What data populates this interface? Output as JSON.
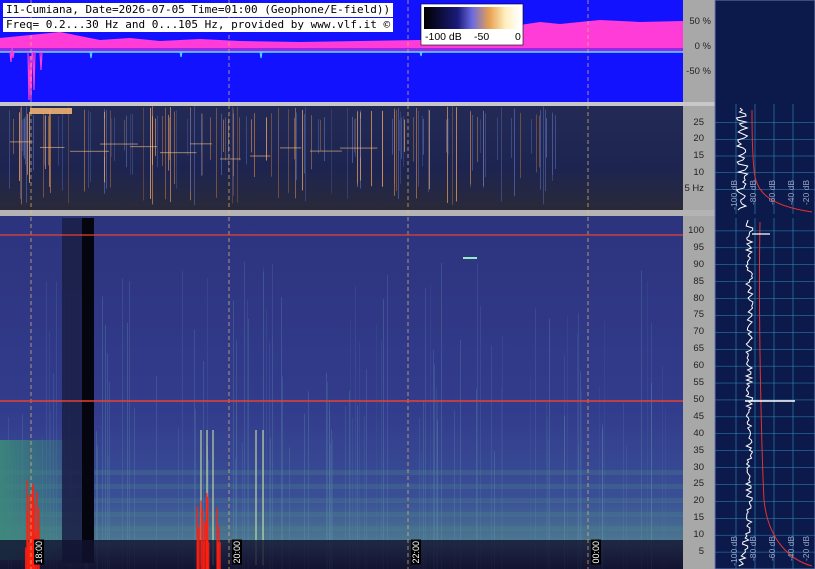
{
  "header": {
    "line1": "I1-Cumiana, Date=2026-07-05 Time=01:00 (Geophone/E-field))",
    "line2": "Freq= 0.2...30 Hz and 0...105 Hz, provided by www.vlf.it ©"
  },
  "colorbar": {
    "labels": [
      "-100 dB",
      "-50",
      "0"
    ]
  },
  "colors": {
    "waveform_bg": "#1212ff",
    "waveform_envelope": "#ff3cd8",
    "waveform_trace": "#56e0ff",
    "spectrogram_bg": "#2e3480",
    "lowband_bg": "#1e2550",
    "panel_gray": "#a8a8a8",
    "profile_bg": "#0b1a4a",
    "profile_grid": "#2f8fbf",
    "hum_line": "#e84030",
    "time_marker": "#f0c070"
  },
  "chart_data": [
    {
      "type": "line",
      "panel": "waveform",
      "title": "",
      "ylabel_ticks": [
        "50 %",
        "0 %",
        "-50 %"
      ],
      "y_values": [
        50,
        0,
        -50
      ],
      "ylim": [
        -100,
        100
      ],
      "series": []
    },
    {
      "type": "heatmap",
      "panel": "spectrogram-0.2-30Hz",
      "y_ticks": [
        "25",
        "20",
        "15",
        "10",
        "5 Hz"
      ],
      "y_values": [
        25,
        20,
        15,
        10,
        5
      ],
      "ylim": [
        0.2,
        30
      ]
    },
    {
      "type": "heatmap",
      "panel": "spectrogram-0-105Hz",
      "y_ticks": [
        "100",
        "95",
        "90",
        "85",
        "80",
        "75",
        "70",
        "65",
        "60",
        "55",
        "50",
        "45",
        "40",
        "35",
        "30",
        "25",
        "20",
        "15",
        "10",
        "5"
      ],
      "y_values": [
        100,
        95,
        90,
        85,
        80,
        75,
        70,
        65,
        60,
        55,
        50,
        45,
        40,
        35,
        30,
        25,
        20,
        15,
        10,
        5
      ],
      "ylim": [
        0,
        105
      ],
      "time_labels": [
        "18:00",
        "20:00",
        "22:00",
        "00:00"
      ],
      "hum_lines_hz": [
        50,
        100
      ]
    },
    {
      "type": "line",
      "panel": "spectral-profiles",
      "db_labels": [
        "-100 dB",
        "-80 dB",
        "-60 dB",
        "-40 dB",
        "-20 dB"
      ]
    }
  ]
}
